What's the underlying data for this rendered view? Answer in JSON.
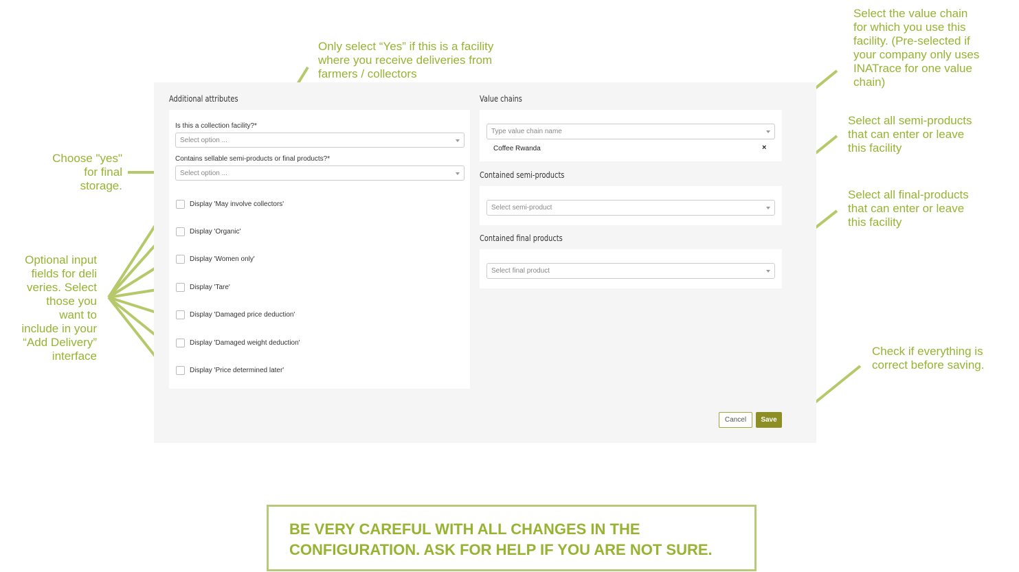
{
  "form": {
    "additional_attributes_title": "Additional attributes",
    "collection_facility_label": "Is this a collection facility?*",
    "collection_facility_placeholder": "Select option ...",
    "sellable_label": "Contains sellable semi-products or final products?*",
    "sellable_placeholder": "Select option ...",
    "checkboxes": [
      "Display 'May involve collectors'",
      "Display 'Organic'",
      "Display 'Women only'",
      "Display 'Tare'",
      "Display 'Damaged price deduction'",
      "Display 'Damaged weight deduction'",
      "Display 'Price determined later'"
    ],
    "value_chains_title": "Value chains",
    "value_chain_placeholder": "Type value chain name",
    "value_chain_selected": "Coffee Rwanda",
    "remove_symbol": "×",
    "semi_products_title": "Contained semi-products",
    "semi_product_placeholder": "Select semi-product",
    "final_products_title": "Contained final products",
    "final_product_placeholder": "Select final product",
    "cancel_label": "Cancel",
    "save_label": "Save"
  },
  "annotations": {
    "collection_note": [
      "Only select “Yes” if this is a facility",
      "where you receive deliveries from",
      "farmers / collectors"
    ],
    "choose_yes_note": [
      "Choose \"yes\"",
      "for final",
      "storage."
    ],
    "optional_fields_note": [
      "Optional input",
      "fields for deli",
      "veries. Select",
      "those you",
      "want to",
      "include in your",
      "“Add Delivery”",
      "interface"
    ],
    "value_chain_note": [
      "Select the value chain",
      "for which you use this",
      "facility. (Pre-selected if",
      "your company only uses",
      "INATrace for one value",
      "chain)"
    ],
    "semi_products_note": [
      "Select all semi-products",
      "that can enter or leave",
      "this facility"
    ],
    "final_products_note": [
      "Select all final-products",
      "that can enter or leave",
      "this facility"
    ],
    "save_note": [
      "Check if everything is",
      "correct before saving."
    ],
    "warning": [
      "BE VERY CAREFUL WITH ALL CHANGES IN THE",
      "CONFIGURATION.  ASK FOR HELP IF YOU ARE NOT SURE."
    ]
  },
  "colors": {
    "annotation_green": "#96b332",
    "arrow_green": "#b5c96a",
    "save_button": "#8d8f25"
  }
}
